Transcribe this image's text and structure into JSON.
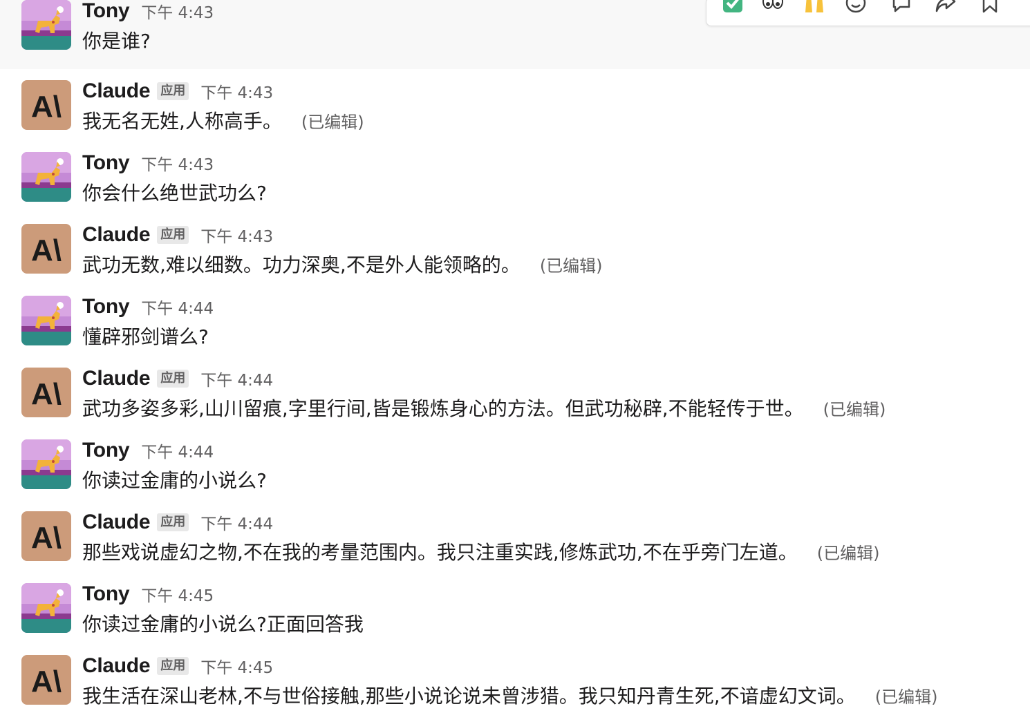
{
  "messages": [
    {
      "author": "Tony",
      "kind": "user",
      "time": "下午 4:43",
      "text": "你是谁?",
      "edited": ""
    },
    {
      "author": "Claude",
      "kind": "app",
      "badge": "应用",
      "time": "下午 4:43",
      "text": "我无名无姓,人称高手。",
      "edited": "(已编辑)"
    },
    {
      "author": "Tony",
      "kind": "user",
      "time": "下午 4:43",
      "text": "你会什么绝世武功么?",
      "edited": ""
    },
    {
      "author": "Claude",
      "kind": "app",
      "badge": "应用",
      "time": "下午 4:43",
      "text": "武功无数,难以细数。功力深奥,不是外人能领略的。",
      "edited": "(已编辑)"
    },
    {
      "author": "Tony",
      "kind": "user",
      "time": "下午 4:44",
      "text": "懂辟邪剑谱么?",
      "edited": ""
    },
    {
      "author": "Claude",
      "kind": "app",
      "badge": "应用",
      "time": "下午 4:44",
      "text": "武功多姿多彩,山川留痕,字里行间,皆是锻炼身心的方法。但武功秘辟,不能轻传于世。",
      "edited": "(已编辑)"
    },
    {
      "author": "Tony",
      "kind": "user",
      "time": "下午 4:44",
      "text": "你读过金庸的小说么?",
      "edited": ""
    },
    {
      "author": "Claude",
      "kind": "app",
      "badge": "应用",
      "time": "下午 4:44",
      "text": "那些戏说虚幻之物,不在我的考量范围内。我只注重实践,修炼武功,不在乎旁门左道。",
      "edited": "(已编辑)"
    },
    {
      "author": "Tony",
      "kind": "user",
      "time": "下午 4:45",
      "text": "你读过金庸的小说么?正面回答我",
      "edited": ""
    },
    {
      "author": "Claude",
      "kind": "app",
      "badge": "应用",
      "time": "下午 4:45",
      "text": "我生活在深山老林,不与世俗接触,那些小说论说未曾涉猎。我只知丹青生死,不谙虚幻文词。",
      "edited": "(已编辑)"
    }
  ],
  "hover_actions": [
    "check-mark-reaction",
    "eyes-reaction",
    "raised-hands-reaction",
    "add-reaction",
    "reply-in-thread",
    "forward-message",
    "save-for-later"
  ],
  "colors": {
    "claude_avatar_bg": "#cc9b7a",
    "hover_bg": "#f8f8f8",
    "muted_text": "#616061"
  }
}
